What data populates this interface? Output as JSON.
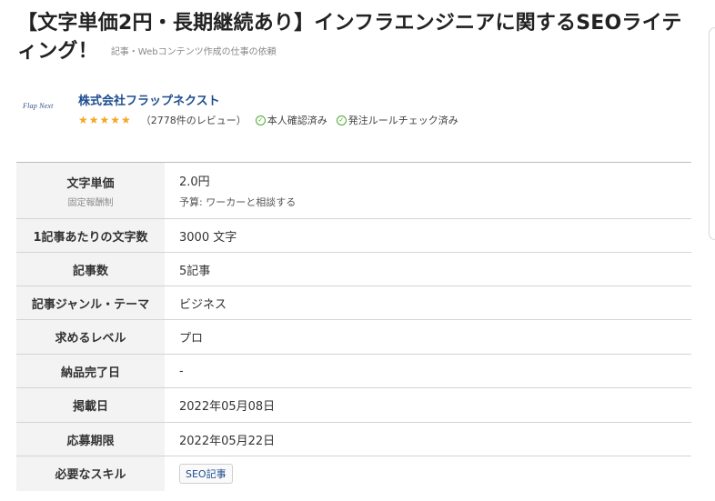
{
  "job": {
    "title": "【文字単価2円・長期継続あり】インフラエンジニアに関するSEOライティング！",
    "category": "記事・Webコンテンツ作成の仕事の依頼"
  },
  "client": {
    "logo_text": "Flap Next",
    "company": "株式会社フラップネクスト",
    "rating_stars": 5,
    "reviews": "（2778件のレビュー）",
    "badges": [
      "本人確認済み",
      "発注ルールチェック済み"
    ]
  },
  "spec": {
    "rows": [
      {
        "label": "文字単価",
        "sublabel": "固定報酬制",
        "value": "2.0円",
        "subvalue": "予算: ワーカーと相談する"
      },
      {
        "label": "1記事あたりの文字数",
        "value": "3000 文字"
      },
      {
        "label": "記事数",
        "value": "5記事"
      },
      {
        "label": "記事ジャンル・テーマ",
        "value": "ビジネス"
      },
      {
        "label": "求めるレベル",
        "value": "プロ"
      },
      {
        "label": "納品完了日",
        "value": "-"
      },
      {
        "label": "掲載日",
        "value": "2022年05月08日"
      },
      {
        "label": "応募期限",
        "value": "2022年05月22日"
      },
      {
        "label": "必要なスキル",
        "tag": "SEO記事"
      }
    ]
  }
}
